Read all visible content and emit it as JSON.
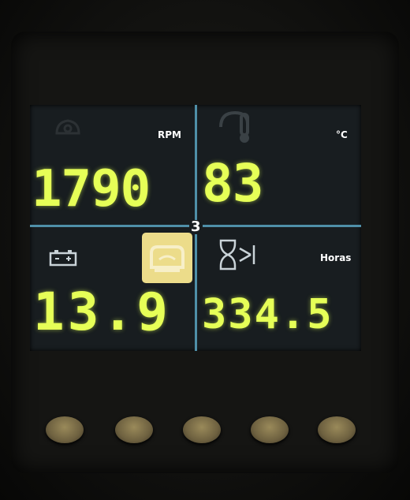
{
  "display": {
    "page_number": "3",
    "quadrants": {
      "rpm": {
        "value": "1790",
        "unit": "RPM",
        "icon": "engine-icon"
      },
      "temperature": {
        "value": "83",
        "unit": "°C",
        "icon": "thermometer-icon"
      },
      "battery": {
        "value": "13.9",
        "icon": "battery-icon"
      },
      "hours": {
        "value": "334.5",
        "unit": "Horas",
        "icon": "hourglass-icon"
      }
    },
    "warning_icon": "engine-warning-icon"
  },
  "colors": {
    "value_text": "#e6ff57",
    "divider": "#4f8fa8",
    "screen_bg": "#181d20",
    "warning_bg": "#ecdc8a"
  },
  "buttons": [
    "softkey-1",
    "softkey-2",
    "softkey-3",
    "softkey-4",
    "softkey-5"
  ]
}
